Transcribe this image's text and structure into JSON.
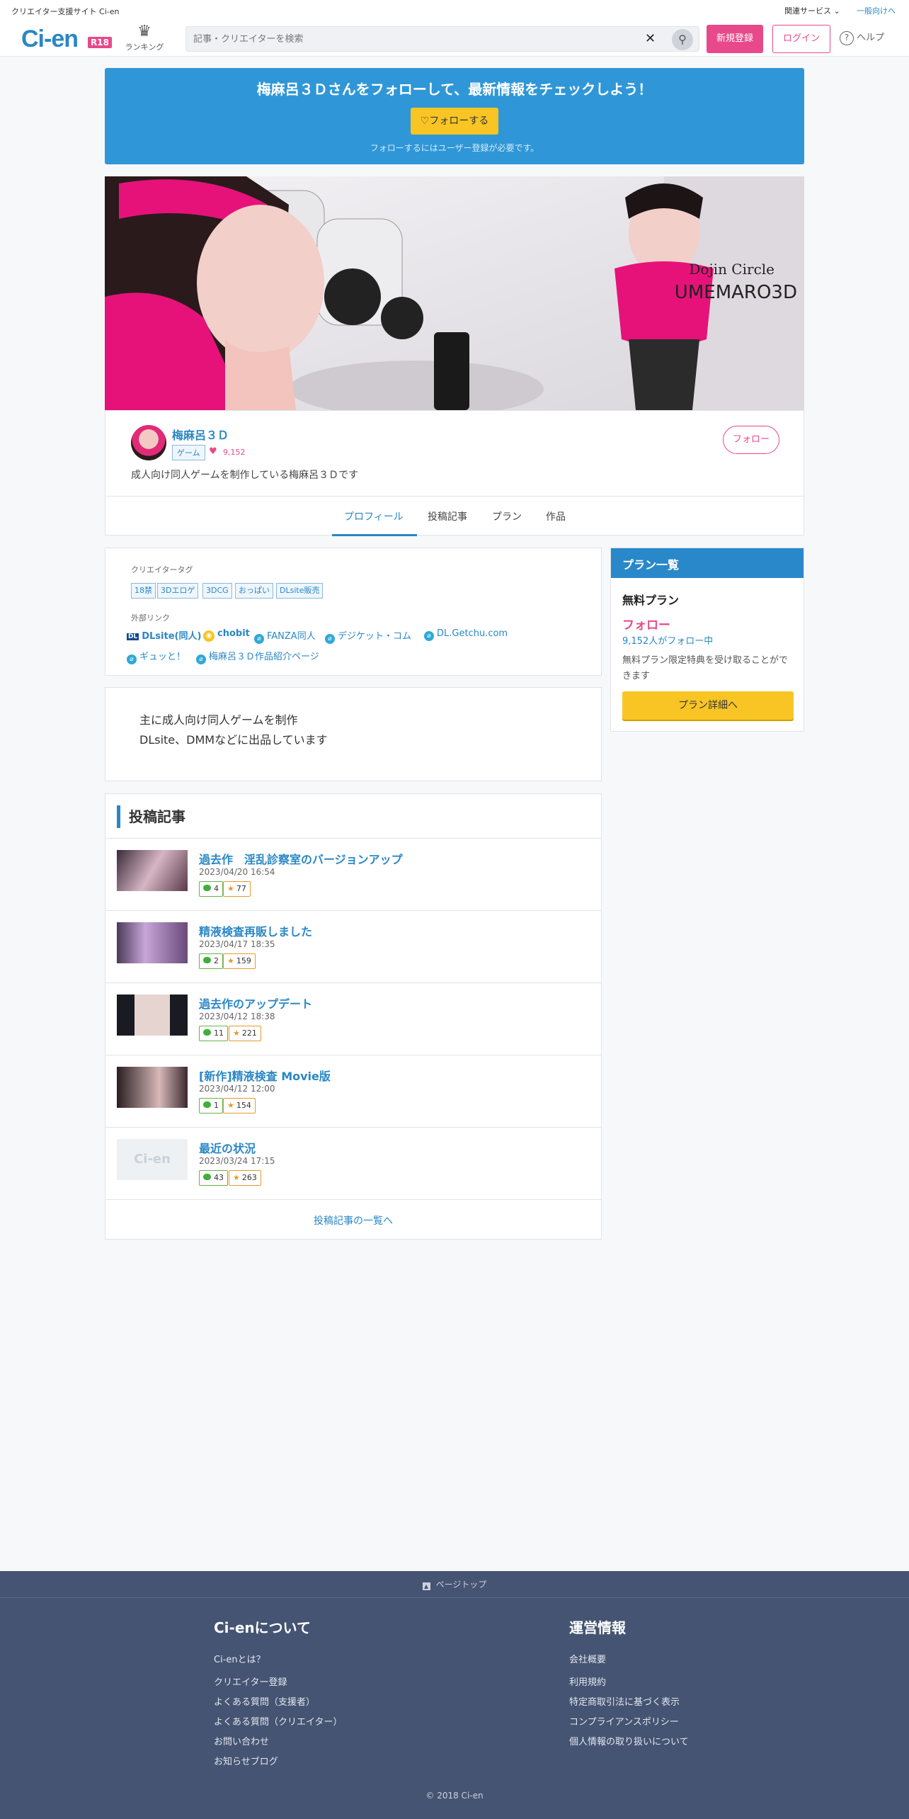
{
  "topbar": {
    "site_label": "クリエイター支援サイト Ci-en",
    "related": "関連サービス",
    "general": "一般向けへ"
  },
  "header": {
    "logo": "Ci-en",
    "logo_badge": "R18",
    "ranking": "ランキング",
    "search_placeholder": "記事・クリエイターを検索",
    "register": "新規登録",
    "login": "ログイン",
    "help": "ヘルプ"
  },
  "follow_banner": {
    "title": "梅麻呂３Ｄさんをフォローして、最新情報をチェックしよう！",
    "button": "フォローする",
    "note": "フォローするにはユーザー登録が必要です。"
  },
  "hero": {
    "circle_label": "Dojin Circle",
    "circle_name": "UMEMARO3D"
  },
  "profile": {
    "name": "梅麻呂３Ｄ",
    "genre": "ゲーム",
    "followers": "9,152",
    "description": "成人向け同人ゲームを制作している梅麻呂３Ｄです",
    "follow_button": "フォロー",
    "tabs": [
      "プロフィール",
      "投稿記事",
      "プラン",
      "作品"
    ]
  },
  "tags_box": {
    "tags_label": "クリエイタータグ",
    "tags": [
      "18禁",
      "3Dエロゲ",
      "3DCG",
      "おっぱい",
      "DLsite販売"
    ],
    "links_label": "外部リンク",
    "links": [
      "DLsite(同人)",
      "chobit",
      "FANZA同人",
      "デジケット・コム",
      "DL.Getchu.com",
      "ギュッと！",
      "梅麻呂３Ｄ作品紹介ページ"
    ]
  },
  "intro": {
    "line1": "主に成人向け同人ゲームを制作",
    "line2": "DLsite、DMMなどに出品しています"
  },
  "posts": {
    "heading": "投稿記事",
    "items": [
      {
        "title": "過去作　淫乱診察室のバージョンアップ",
        "date": "2023/04/20 16:54",
        "comments": "4",
        "likes": "77"
      },
      {
        "title": "精液検査再販しました",
        "date": "2023/04/17 18:35",
        "comments": "2",
        "likes": "159"
      },
      {
        "title": "過去作のアップデート",
        "date": "2023/04/12 18:38",
        "comments": "11",
        "likes": "221"
      },
      {
        "title": "[新作]精液検査 Movie版",
        "date": "2023/04/12 12:00",
        "comments": "1",
        "likes": "154"
      },
      {
        "title": "最近の状況",
        "date": "2023/03/24 17:15",
        "comments": "43",
        "likes": "263"
      }
    ],
    "placeholder_thumb": "Ci-en",
    "more": "投稿記事の一覧へ"
  },
  "plan": {
    "header": "プラン一覧",
    "title": "無料プラン",
    "follow": "フォロー",
    "count": "9,152人がフォロー中",
    "description": "無料プラン限定特典を受け取ることができます",
    "button": "プラン詳細へ"
  },
  "footer": {
    "page_top": "ページトップ",
    "about_title": "Ci-enについて",
    "about_links": [
      "Ci-enとは？",
      "クリエイター登録",
      "よくある質問（支援者）",
      "よくある質問（クリエイター）",
      "お問い合わせ",
      "お知らせブログ"
    ],
    "ops_title": "運営情報",
    "ops_links": [
      "会社概要",
      "利用規約",
      "特定商取引法に基づく表示",
      "コンプライアンスポリシー",
      "個人情報の取り扱いについて"
    ],
    "copyright": "© 2018 Ci-en"
  },
  "colors": {
    "accent": "#2a87c5",
    "pink": "#e8498a",
    "yellow": "#f9c524",
    "footer": "#455472"
  }
}
